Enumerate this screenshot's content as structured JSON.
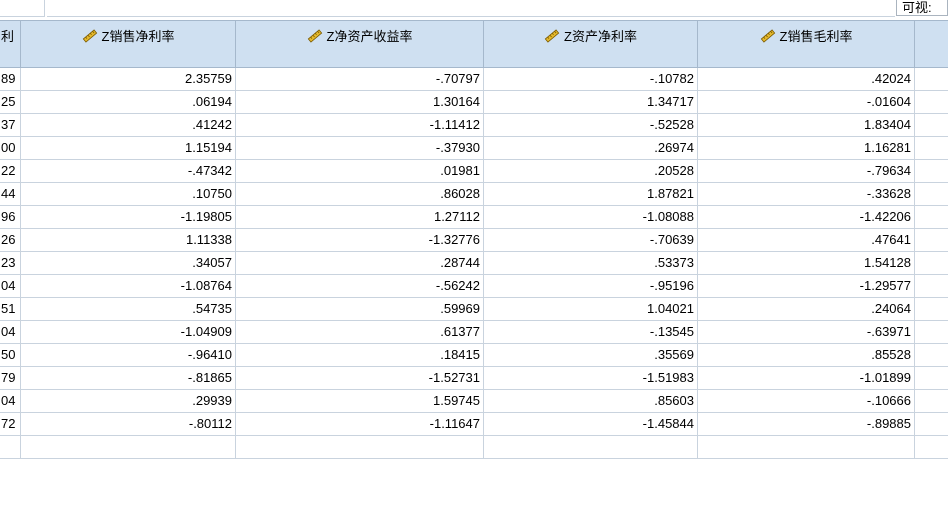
{
  "toolbar": {
    "visible_label": "可视:"
  },
  "columns": [
    {
      "label": "利",
      "first": true
    },
    {
      "label": "Z销售净利率"
    },
    {
      "label": "Z净资产收益率"
    },
    {
      "label": "Z资产净利率"
    },
    {
      "label": "Z销售毛利率"
    },
    {
      "label": ""
    }
  ],
  "rows": [
    [
      "89",
      "2.35759",
      "-.70797",
      "-.10782",
      ".42024",
      ""
    ],
    [
      "25",
      ".06194",
      "1.30164",
      "1.34717",
      "-.01604",
      ""
    ],
    [
      "37",
      ".41242",
      "-1.11412",
      "-.52528",
      "1.83404",
      ""
    ],
    [
      "00",
      "1.15194",
      "-.37930",
      ".26974",
      "1.16281",
      ""
    ],
    [
      "22",
      "-.47342",
      ".01981",
      ".20528",
      "-.79634",
      ""
    ],
    [
      "44",
      ".10750",
      ".86028",
      "1.87821",
      "-.33628",
      ""
    ],
    [
      "96",
      "-1.19805",
      "1.27112",
      "-1.08088",
      "-1.42206",
      ""
    ],
    [
      "26",
      "1.11338",
      "-1.32776",
      "-.70639",
      ".47641",
      ""
    ],
    [
      "23",
      ".34057",
      ".28744",
      ".53373",
      "1.54128",
      ""
    ],
    [
      "04",
      "-1.08764",
      "-.56242",
      "-.95196",
      "-1.29577",
      ""
    ],
    [
      "51",
      ".54735",
      ".59969",
      "1.04021",
      ".24064",
      ""
    ],
    [
      "04",
      "-1.04909",
      ".61377",
      "-.13545",
      "-.63971",
      ""
    ],
    [
      "50",
      "-.96410",
      ".18415",
      ".35569",
      ".85528",
      ""
    ],
    [
      "79",
      "-.81865",
      "-1.52731",
      "-1.51983",
      "-1.01899",
      ""
    ],
    [
      "04",
      ".29939",
      "1.59745",
      ".85603",
      "-.10666",
      ""
    ],
    [
      "72",
      "-.80112",
      "-1.11647",
      "-1.45844",
      "-.89885",
      ""
    ],
    [
      "",
      "",
      "",
      "",
      "",
      ""
    ]
  ],
  "colors": {
    "header_bg": "#cfe0f1",
    "grid_line": "#c9d3de"
  },
  "icons": {
    "measure_icon": "pencil-ruler-icon"
  }
}
